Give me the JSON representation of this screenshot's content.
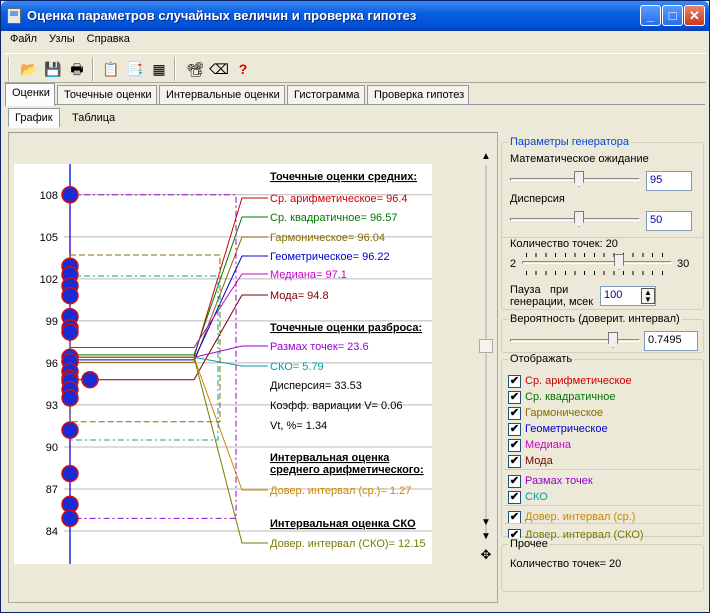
{
  "window": {
    "title": "Оценка параметров случайных величин и проверка гипотез"
  },
  "menu": {
    "items": [
      "Файл",
      "Узлы",
      "Справка"
    ]
  },
  "toolbar": {
    "icons": [
      "open-icon",
      "save-icon",
      "print-icon",
      "copy-icon",
      "export-icon",
      "chart-icon",
      "info-icon",
      "eraser-icon",
      "help-icon"
    ]
  },
  "tabs_main": [
    "Оценки",
    "Точечные оценки",
    "Интервальные оценки",
    "Гистограмма",
    "Проверка гипотез"
  ],
  "tabs_sub": [
    "График",
    "Таблица"
  ],
  "chart_data": {
    "type": "scatter",
    "y_ticks": [
      108,
      105,
      102,
      99,
      96,
      93,
      90,
      87,
      84
    ],
    "ylim": [
      83.5,
      109.2
    ],
    "points": [
      108,
      102.9,
      102.3,
      101.5,
      100.8,
      99.3,
      98.5,
      98.2,
      96.4,
      96.1,
      95.4,
      94.9,
      94.7,
      94.1,
      93.5,
      91.2,
      88.1,
      85.9,
      84.9
    ],
    "mean_point": 94.8,
    "annotations": {
      "means_title": "Точечные оценки средних:",
      "arith": "Ср. арифметическое= 96.4",
      "quad": "Ср. квадратичное= 96.57",
      "harm": "Гармоническое= 96.04",
      "geom": "Геометрическое= 96.22",
      "median": "Медиана= 97.1",
      "mode": "Мода= 94.8",
      "spread_title": "Точечные оценки разброса:",
      "range": "Размах точек= 23.6",
      "sko": "СКО= 5.79",
      "disp": "Дисперсия= 33.53",
      "var": "Коэфф. вариации V= 0.06",
      "vt": "Vt, %= 1.34",
      "int_title1": "Интервальная оценка",
      "int_title2": "среднего арифметического:",
      "ci_mean": "Довер. интервал (ср.)= 1.27",
      "int_sko_title": "Интервальная оценка СКО",
      "ci_sko": "Довер. интервал (СКО)= 12.15"
    },
    "colors": {
      "arith": "#cc0000",
      "quad": "#007700",
      "harm": "#8a6a00",
      "geom": "#0000cc",
      "median": "#cc00cc",
      "mode": "#7a0000",
      "range": "#9900cc",
      "sko": "#00a0a0",
      "ci_mean": "#cc8800",
      "ci_sko": "#7a7a00",
      "point": "#1a2bd6"
    }
  },
  "generator": {
    "title": "Параметры генератора",
    "expect_label": "Математическое ожидание",
    "expect_value": "95",
    "disp_label": "Дисперсия",
    "disp_value": "50",
    "count_label": "Количество точек: 20",
    "count_min": "2",
    "count_max": "30",
    "pause_label1": "Пауза",
    "pause_label2": "при",
    "pause_label3": "генерации, мсек",
    "pause_value": "100"
  },
  "probability": {
    "title": "Вероятность (доверит. интервал)",
    "value": "0.7495"
  },
  "display": {
    "title": "Отображать",
    "items": [
      {
        "label": "Ср. арифметическое",
        "color": "#cc0000"
      },
      {
        "label": "Ср. квадратичное",
        "color": "#007700"
      },
      {
        "label": "Гармоническое",
        "color": "#8a6a00"
      },
      {
        "label": "Геометрическое",
        "color": "#0000cc"
      },
      {
        "label": "Медиана",
        "color": "#cc00cc"
      },
      {
        "label": "Мода",
        "color": "#7a0000"
      },
      {
        "label": "Размах точек",
        "color": "#9900cc"
      },
      {
        "label": "СКО",
        "color": "#00a0a0"
      },
      {
        "label": "Довер. интервал (ср.)",
        "color": "#cc8800"
      },
      {
        "label": "Довер. интервал (СКО)",
        "color": "#7a7a00"
      }
    ]
  },
  "other": {
    "title": "Прочее",
    "count": "Количество точек= 20"
  }
}
